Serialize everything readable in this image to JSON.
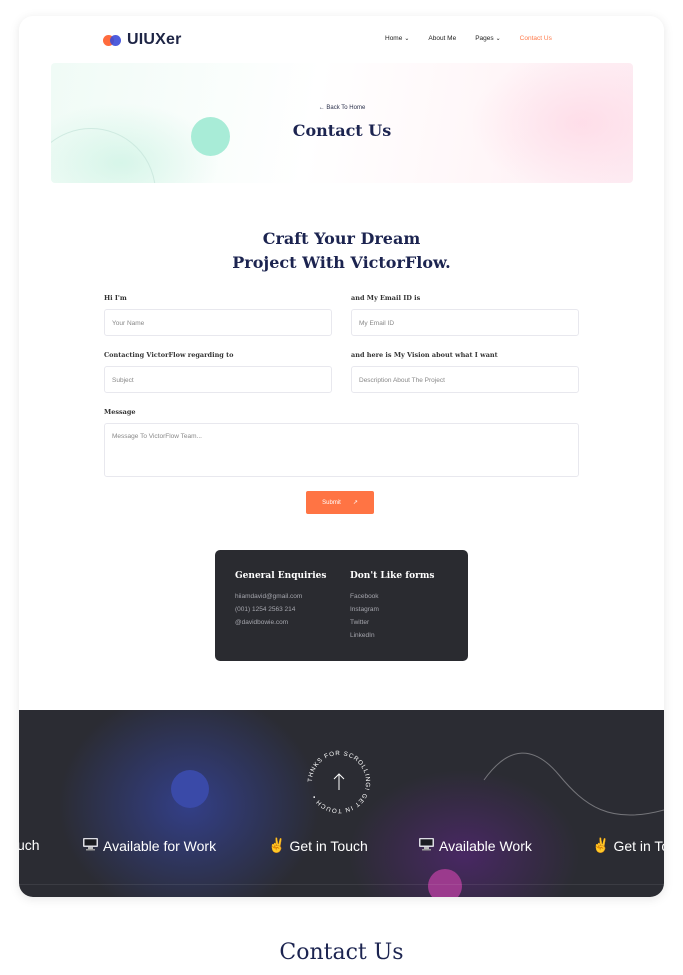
{
  "brand": {
    "name": "UIUXer"
  },
  "nav": {
    "items": [
      {
        "label": "Home",
        "has_dropdown": true
      },
      {
        "label": "About Me",
        "has_dropdown": false
      },
      {
        "label": "Pages",
        "has_dropdown": true
      },
      {
        "label": "Contact Us",
        "has_dropdown": false,
        "active": true
      }
    ]
  },
  "hero": {
    "back_label": "← Back To Home",
    "title": "Contact Us"
  },
  "form": {
    "heading_line1": "Craft Your Dream",
    "heading_line2": "Project With VictorFlow.",
    "name_label": "Hi I'm",
    "name_placeholder": "Your Name",
    "email_label": "and My Email ID is",
    "email_placeholder": "My Email ID",
    "subject_label": "Contacting VictorFlow regarding to",
    "subject_placeholder": "Subject",
    "vision_label": "and here is My Vision about what I want",
    "vision_placeholder": "Description About The Project",
    "message_label": "Message",
    "message_placeholder": "Message To VictorFlow Team...",
    "submit_label": "Submit",
    "submit_icon": "↗"
  },
  "info": {
    "enquiries_heading": "General Enquiries",
    "enquiries": [
      "hiiamdavid@gmail.com",
      "(001) 1254 2563 214",
      "@davidbowie.com"
    ],
    "forms_heading": "Don't Like forms",
    "links": [
      "Facebook",
      "Instagram",
      "Twitter",
      "LinkedIn"
    ]
  },
  "footer": {
    "scroll_badge_text": "THNKS FOR SCROLLING! GET IN TOUCH •",
    "marquee": [
      {
        "text": "uch",
        "icon": ""
      },
      {
        "text": "Available for Work",
        "icon": "computer-icon"
      },
      {
        "text": "Get in Touch",
        "icon": "victory-hand-icon"
      },
      {
        "text": "Available Work",
        "icon": "computer-icon"
      },
      {
        "text": "Get in To",
        "icon": "victory-hand-icon"
      }
    ]
  },
  "caption": "Contact Us",
  "colors": {
    "accent": "#ff7444",
    "navy": "#1c2450",
    "dark": "#2a2b30"
  }
}
